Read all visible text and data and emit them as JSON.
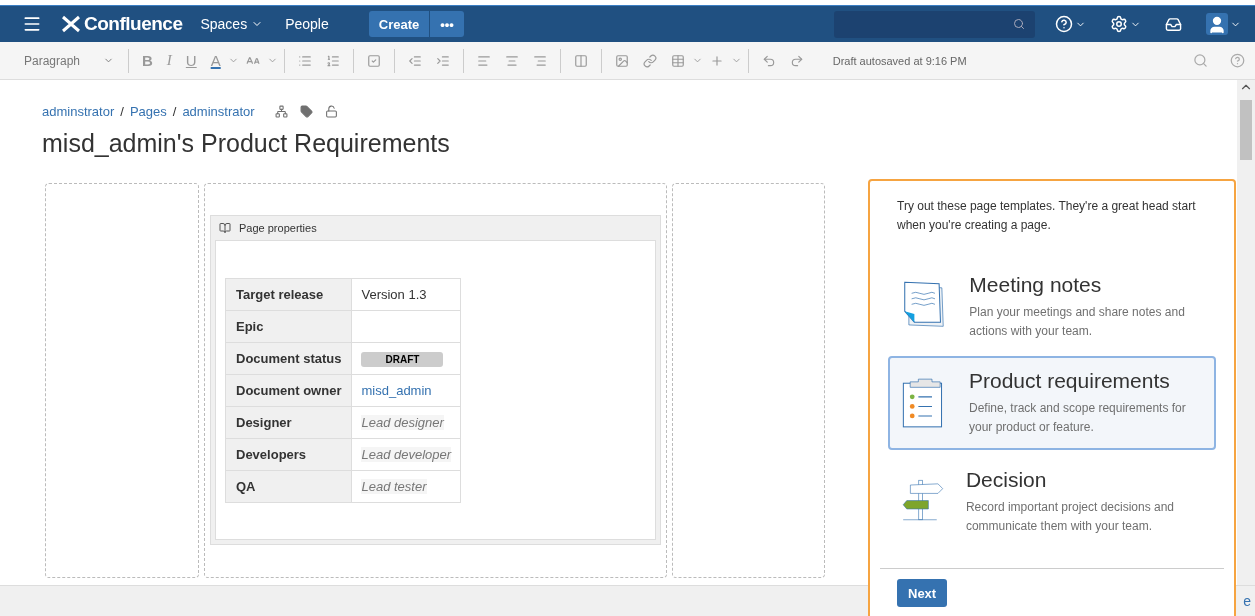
{
  "nav": {
    "logo": "Confluence",
    "menu_items": [
      {
        "label": "Spaces",
        "dropdown": true
      },
      {
        "label": "People",
        "dropdown": false
      }
    ],
    "create_button": "Create",
    "more_button": "•••"
  },
  "toolbar": {
    "style_select": "Paragraph",
    "format_letters": [
      "B",
      "I",
      "U",
      "A"
    ],
    "status": "Draft autosaved at 9:16 PM"
  },
  "breadcrumbs": [
    "adminstrator",
    "/",
    "Pages",
    "/",
    "adminstrator"
  ],
  "page_title": "misd_admin's Product Requirements",
  "page_properties": {
    "title": "Page properties",
    "rows": [
      {
        "label": "Target release",
        "kind": "text",
        "value": "Version 1.3"
      },
      {
        "label": "Epic",
        "kind": "empty"
      },
      {
        "label": "Document status",
        "kind": "status",
        "value": "DRAFT"
      },
      {
        "label": "Document owner",
        "kind": "user",
        "value": "misd_admin"
      },
      {
        "label": "Designer",
        "kind": "placeholder",
        "value": "Lead designer"
      },
      {
        "label": "Developers",
        "kind": "placeholder",
        "value": "Lead developer"
      },
      {
        "label": "QA",
        "kind": "placeholder",
        "value": "Lead tester"
      }
    ]
  },
  "template_panel": {
    "intro": "Try out these page templates. They're a great head start when you're creating a page.",
    "templates": [
      {
        "kind": "notes",
        "title": "Meeting notes",
        "description": "Plan your meetings and share notes and actions with your team.",
        "selected": false
      },
      {
        "kind": "requirements",
        "title": "Product requirements",
        "description": "Define, track and scope requirements for your product or feature.",
        "selected": true
      },
      {
        "kind": "decision",
        "title": "Decision",
        "description": "Record important project decisions and communicate them with your team.",
        "selected": false
      }
    ],
    "next_button": "Next"
  },
  "footer": {
    "text": "e"
  }
}
